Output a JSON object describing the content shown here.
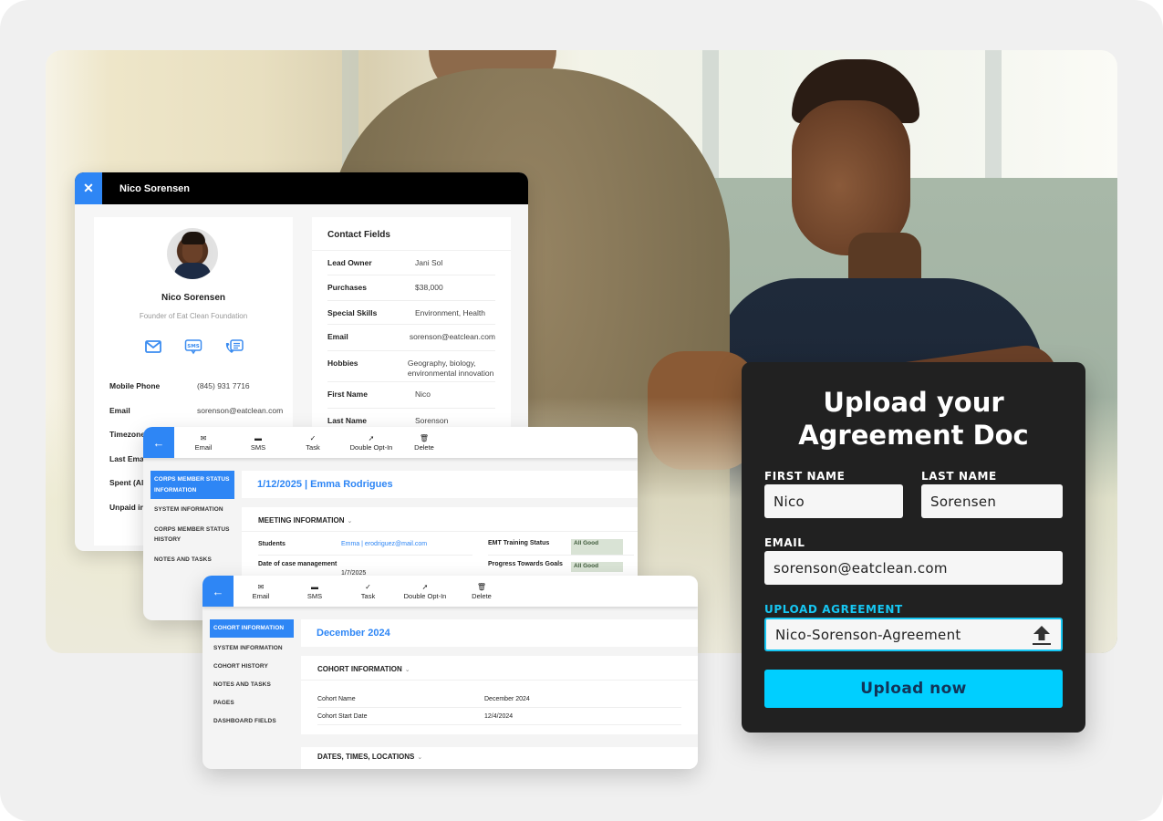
{
  "contact_card": {
    "close_icon": "close-icon",
    "title": "Nico Sorensen",
    "profile": {
      "name": "Nico Sorensen",
      "role": "Founder of Eat Clean Foundation",
      "actions": [
        {
          "icon": "email-icon",
          "label": "Email"
        },
        {
          "icon": "sms-icon",
          "label": "SMS"
        },
        {
          "icon": "phone-list-icon",
          "label": "Call log"
        }
      ],
      "fields": [
        {
          "label": "Mobile Phone",
          "value": "(845) 931 7716"
        },
        {
          "label": "Email",
          "value": "sorenson@eatclean.com"
        },
        {
          "label": "Timezone",
          "value": ""
        },
        {
          "label": "Last Email",
          "value": ""
        },
        {
          "label": "Spent (All",
          "value": ""
        },
        {
          "label": "Unpaid in",
          "value": ""
        }
      ]
    },
    "contact_fields": {
      "title": "Contact Fields",
      "rows": [
        {
          "label": "Lead Owner",
          "value": "Jani Sol"
        },
        {
          "label": "Purchases",
          "value": "$38,000"
        },
        {
          "label": "Special Skills",
          "value": "Environment, Health"
        },
        {
          "label": "Email",
          "value": "sorenson@eatclean.com"
        },
        {
          "label": "Hobbies",
          "value": "Geography, biology, environmental innovation"
        },
        {
          "label": "First Name",
          "value": "Nico"
        },
        {
          "label": "Last Name",
          "value": "Sorenson"
        }
      ]
    }
  },
  "toolbar": {
    "back_icon": "arrow-left-icon",
    "items": [
      {
        "icon": "envelope-icon",
        "label": "Email"
      },
      {
        "icon": "chat-icon",
        "label": "SMS"
      },
      {
        "icon": "check-icon",
        "label": "Task"
      },
      {
        "icon": "cursor-click-icon",
        "label": "Double Opt-In"
      },
      {
        "icon": "trash-icon",
        "label": "Delete"
      }
    ]
  },
  "record_corps": {
    "sidebar": [
      {
        "label": "CORPS MEMBER STATUS INFORMATION",
        "active": true
      },
      {
        "label": "SYSTEM INFORMATION",
        "active": false
      },
      {
        "label": "CORPS MEMBER STATUS HISTORY",
        "active": false
      },
      {
        "label": "NOTES AND TASKS",
        "active": false
      }
    ],
    "heading": "1/12/2025 | Emma Rodrigues",
    "section_title": "MEETING INFORMATION",
    "left_rows": [
      {
        "label": "Students",
        "value": "Emma | erodriguez@mail.com"
      },
      {
        "label": "Date of case management",
        "value": "1/7/2025"
      }
    ],
    "right_rows": [
      {
        "label": "EMT Training Status",
        "value": "All Good"
      },
      {
        "label": "Progress Towards Goals",
        "value": "All Good"
      }
    ]
  },
  "record_cohort": {
    "sidebar": [
      {
        "label": "COHORT INFORMATION",
        "active": true
      },
      {
        "label": "SYSTEM INFORMATION",
        "active": false
      },
      {
        "label": "COHORT HISTORY",
        "active": false
      },
      {
        "label": "NOTES AND TASKS",
        "active": false
      },
      {
        "label": "PAGES",
        "active": false
      },
      {
        "label": "DASHBOARD FIELDS",
        "active": false
      }
    ],
    "heading": "December 2024",
    "section_title": "COHORT INFORMATION",
    "rows": [
      {
        "label": "Cohort Name",
        "value": "December 2024"
      },
      {
        "label": "Cohort Start Date",
        "value": "12/4/2024"
      }
    ],
    "section2_title": "DATES, TIMES, LOCATIONS"
  },
  "upload_form": {
    "title_line1": "Upload your",
    "title_line2": "Agreement Doc",
    "first_name_label": "FIRST NAME",
    "first_name_value": "Nico",
    "last_name_label": "LAST NAME",
    "last_name_value": "Sorensen",
    "email_label": "EMAIL",
    "email_value": "sorenson@eatclean.com",
    "upload_label": "UPLOAD AGREEMENT",
    "upload_value": "Nico-Sorenson-Agreement",
    "upload_icon": "upload-icon",
    "submit_label": "Upload now",
    "accent_color": "#16c6f2",
    "button_color": "#00cfff"
  },
  "colors": {
    "brand_blue": "#2e86f5",
    "badge_green": "#d9e3d5"
  }
}
